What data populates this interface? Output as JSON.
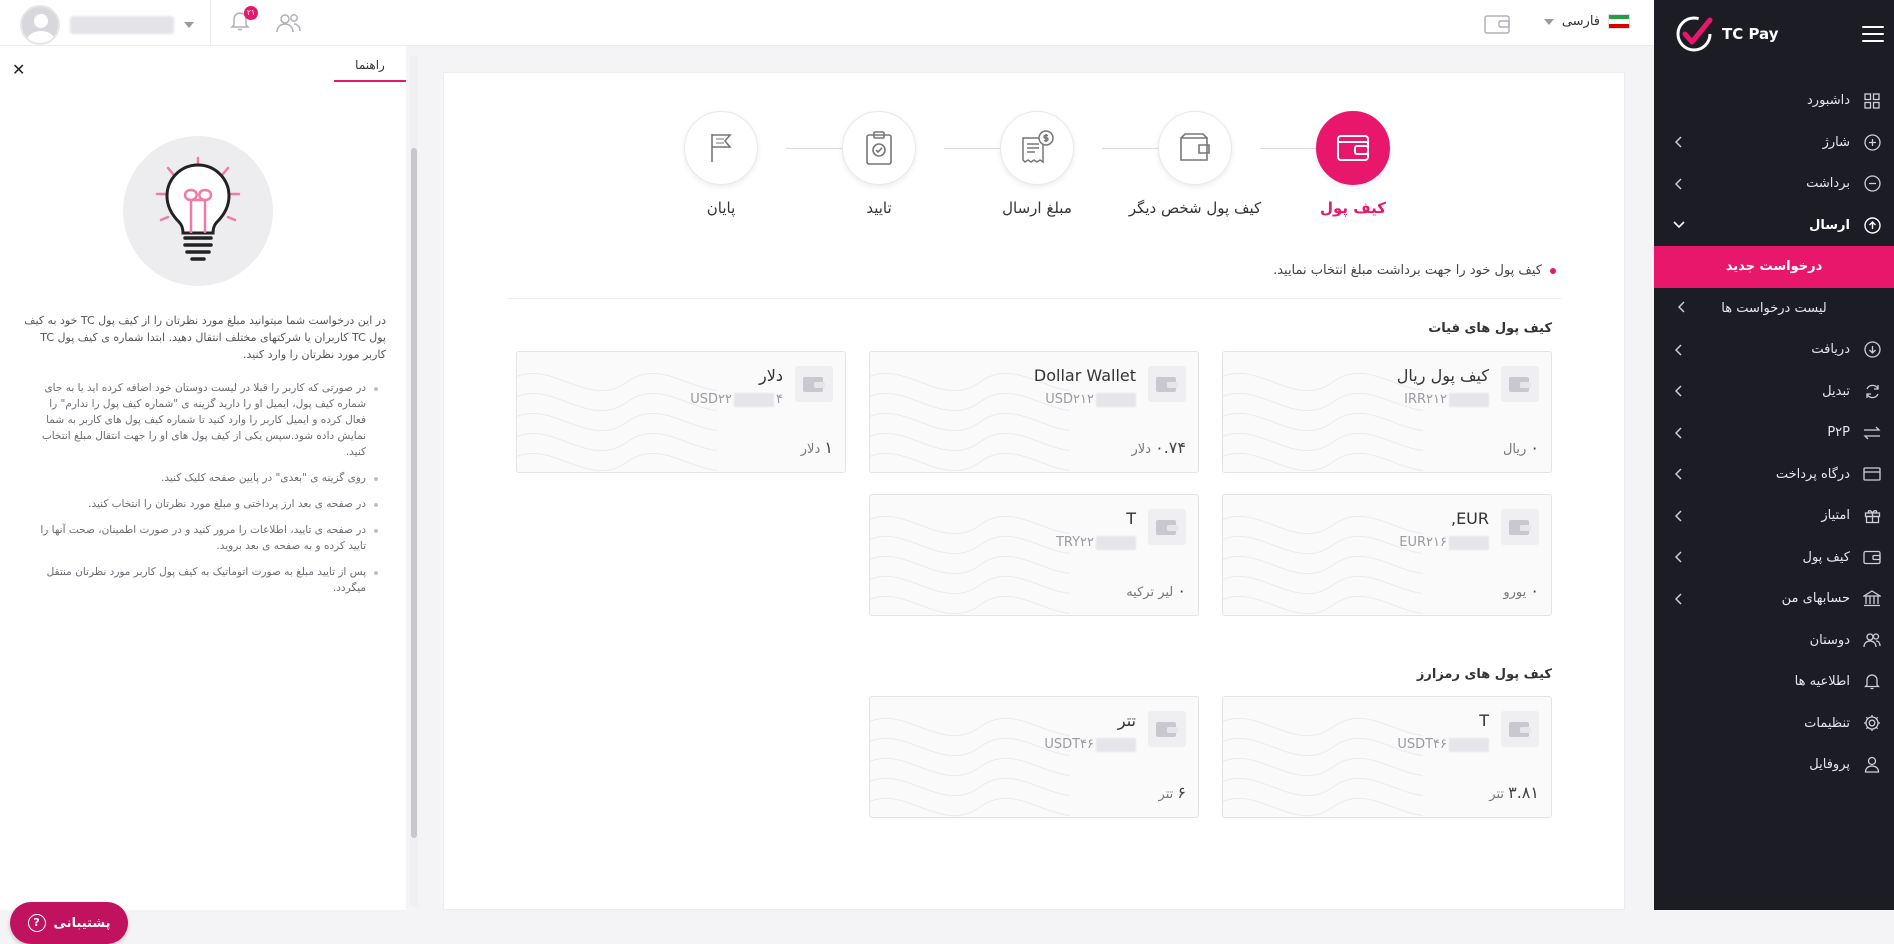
{
  "brand": {
    "title": "TC Pay",
    "accent": "#e8176b"
  },
  "topbar": {
    "lang_label": "فارسی",
    "notif_count": "۲۱"
  },
  "sidebar": {
    "items": [
      {
        "label": "داشبورد",
        "icon": "dashboard-icon",
        "chevron": false
      },
      {
        "label": "شارژ",
        "icon": "plus-circle-icon",
        "chevron": true
      },
      {
        "label": "برداشت",
        "icon": "minus-circle-icon",
        "chevron": true
      },
      {
        "label": "ارسال",
        "icon": "send-icon",
        "chevron": true,
        "open": true
      },
      {
        "label": "دریافت",
        "icon": "receive-icon",
        "chevron": true
      },
      {
        "label": "تبدیل",
        "icon": "exchange-icon",
        "chevron": true
      },
      {
        "label": "P۲P",
        "icon": "p2p-icon",
        "chevron": true
      },
      {
        "label": "درگاه پرداخت",
        "icon": "card-icon",
        "chevron": true
      },
      {
        "label": "امتیاز",
        "icon": "gift-icon",
        "chevron": true
      },
      {
        "label": "کیف پول",
        "icon": "wallet-icon",
        "chevron": true
      },
      {
        "label": "حسابهای من",
        "icon": "bank-icon",
        "chevron": true
      },
      {
        "label": "دوستان",
        "icon": "friends-icon",
        "chevron": false
      },
      {
        "label": "اطلاعیه ها",
        "icon": "bell-icon",
        "chevron": false
      },
      {
        "label": "تنظیمات",
        "icon": "gear-icon",
        "chevron": false
      },
      {
        "label": "پروفایل",
        "icon": "user-icon",
        "chevron": false
      }
    ],
    "sub": {
      "new_request": "درخواست جدید",
      "request_list": "لیست درخواست ها"
    }
  },
  "help": {
    "tab": "راهنما",
    "close": "✕",
    "intro": "در این درخواست شما میتوانید مبلغ مورد نظرتان را از کیف پول TC خود به کیف پول TC کاربران یا شرکتهای مختلف انتقال دهید. ابتدا شماره ی کیف پول TC کاربر مورد نظرتان را وارد کنید.",
    "bullets": [
      "در صورتی که کاربر را قبلا در لیست دوستان خود اضافه کرده اید یا به جای شماره کیف پول، ایمیل او را دارید گزینه ی \"شماره کیف پول را ندارم\" را فعال کرده و ایمیل کاربر را وارد کنید تا شماره کیف پول های کاربر به شما نمایش داده شود.سپس یکی از کیف پول های او را جهت انتقال مبلغ انتخاب کنید.",
      "روی گزینه ی \"بعدی\" در پایین صفحه کلیک کنید.",
      "در صفحه ی بعد ارز پرداختی و مبلغ مورد نظرتان را انتخاب کنید.",
      "در صفحه ی تایید، اطلاعات را مرور کنید و در صورت اطمینان، صحت آنها را تایید کرده و به صفحه ی بعد بروید.",
      "پس از تایید مبلغ به صورت اتوماتیک به کیف پول کاربر مورد نظرتان منتقل میگردد."
    ],
    "support": "پشتیبانی"
  },
  "steps": [
    {
      "label": "کیف پول",
      "icon": "wallet-icon",
      "active": true
    },
    {
      "label": "کیف پول شخص دیگر",
      "icon": "wallet-outline-icon",
      "active": false
    },
    {
      "label": "مبلغ ارسال",
      "icon": "invoice-icon",
      "active": false
    },
    {
      "label": "تایید",
      "icon": "clipboard-check-icon",
      "active": false
    },
    {
      "label": "پایان",
      "icon": "flag-icon",
      "active": false
    }
  ],
  "main": {
    "instruction": "کیف پول خود را جهت برداشت مبلغ انتخاب نمایید.",
    "fiat_title": "کیف پول های فیات",
    "crypto_title": "کیف پول های رمزارز"
  },
  "fiat_wallets": [
    {
      "name": "کیف پول ریال",
      "code": "IRR۲۱۲",
      "balance": "۰",
      "unit": "ریال"
    },
    {
      "name": "Dollar Wallet",
      "code": "USD۲۱۲",
      "balance": "۰.۷۴",
      "unit": "دلار"
    },
    {
      "name": "دلار",
      "code": "USD۲۲",
      "code_suffix": "۴",
      "balance": "۱",
      "unit": "دلار"
    },
    {
      "name": "EUR,",
      "code": "EUR۲۱۶",
      "balance": "۰",
      "unit": "یورو"
    },
    {
      "name": "T",
      "code": "TRY۲۲",
      "balance": "۰",
      "unit": "لیر ترکیه"
    }
  ],
  "crypto_wallets": [
    {
      "name": "T",
      "code": "USDT۴۶",
      "balance": "۳.۸۱",
      "unit": "تتر"
    },
    {
      "name": "تتر",
      "code": "USDT۴۶",
      "balance": "۶",
      "unit": "تتر"
    }
  ]
}
